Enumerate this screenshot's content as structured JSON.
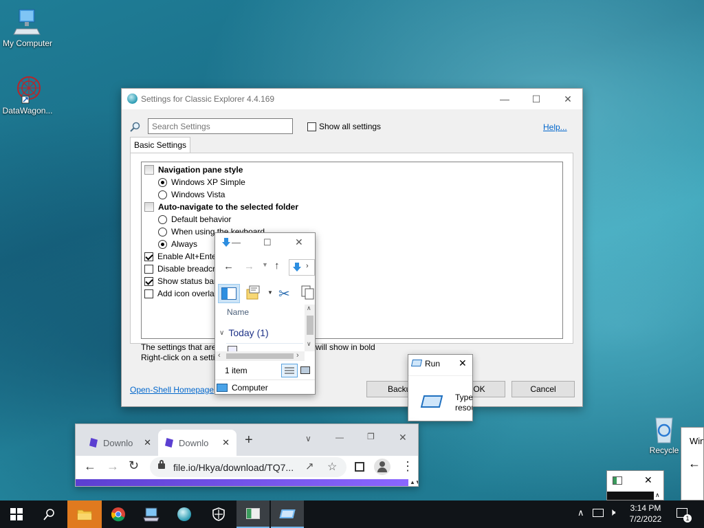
{
  "desktop": {
    "icons": [
      {
        "label": "My Computer"
      },
      {
        "label": "DataWagon..."
      },
      {
        "label": "Recycle"
      }
    ]
  },
  "settings": {
    "title": "Settings for Classic Explorer 4.4.169",
    "search_placeholder": "Search Settings",
    "show_all_label": "Show all settings",
    "show_all_checked": false,
    "help_label": "Help...",
    "tab_label": "Basic Settings",
    "groups": [
      {
        "title": "Navigation pane style",
        "options": [
          "Windows XP Simple",
          "Windows Vista"
        ],
        "selected": 0
      },
      {
        "title": "Auto-navigate to the selected folder",
        "options": [
          "Default behavior",
          "When using the keyboard",
          "Always"
        ],
        "selected": 2
      }
    ],
    "checks": [
      {
        "label": "Enable Alt+Ente",
        "checked": true
      },
      {
        "label": "Disable breadcr",
        "checked": false
      },
      {
        "label": "Show status bar",
        "checked": true
      },
      {
        "label": "Add icon overla",
        "checked": false
      }
    ],
    "info_line1_left": "The settings that are",
    "info_line1_right": "will show in bold",
    "info_line2": "Right-click on a setti",
    "homepage_link": "Open-Shell Homepage",
    "backup_label": "Backup",
    "ok_label": "OK",
    "cancel_label": "Cancel"
  },
  "explorer": {
    "name_header": "Name",
    "group_label": "Today (1)",
    "status_items": "1 item",
    "nav_item": "Computer"
  },
  "run": {
    "title": "Run",
    "text_line1": "Type",
    "text_line2": "resou"
  },
  "chrome": {
    "tabs": [
      {
        "label": "Downlo"
      },
      {
        "label": "Downlo"
      }
    ],
    "url": "file.io/Hkya/download/TQ7..."
  },
  "small_window": {
    "text": "Win"
  },
  "taskbar": {
    "time": "3:14 PM",
    "date": "7/2/2022",
    "notification_count": "1"
  },
  "colors": {
    "accent": "#0078d7",
    "link": "#0066cc",
    "chrome_progress": "#7b61ff"
  }
}
